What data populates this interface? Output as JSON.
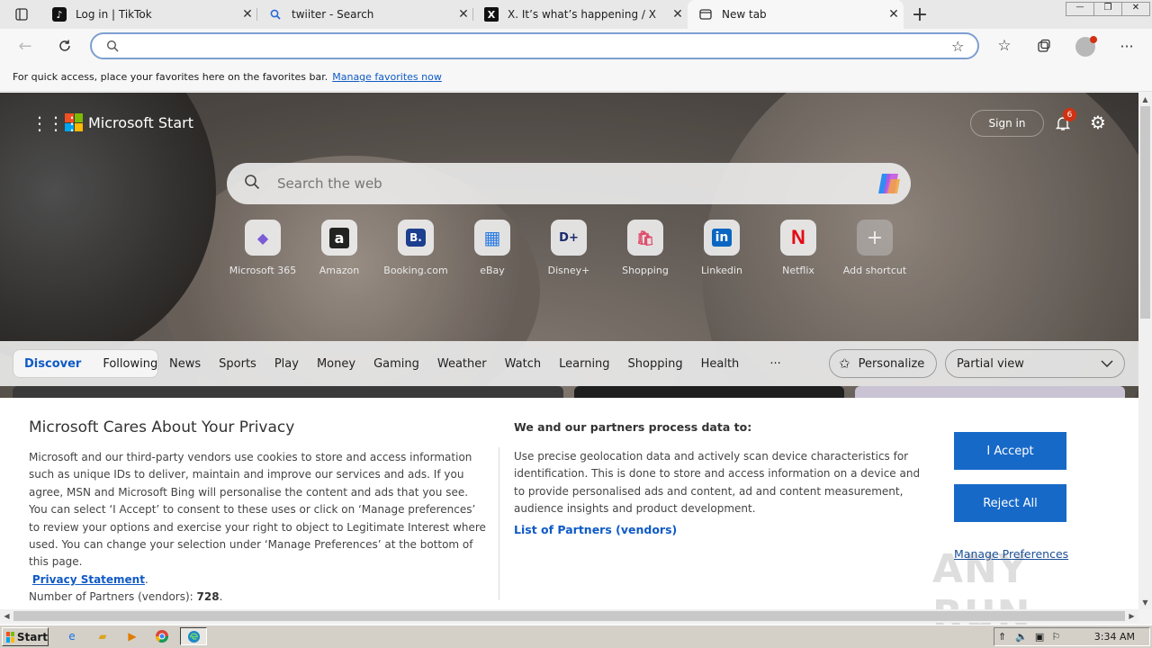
{
  "tabs": [
    {
      "title": "Log in | TikTok",
      "icon": "tiktok-icon"
    },
    {
      "title": "twiiter - Search",
      "icon": "search-icon"
    },
    {
      "title": "X. It’s what’s happening / X",
      "icon": "x-logo-icon"
    },
    {
      "title": "New tab",
      "icon": "new-tab-icon"
    }
  ],
  "tab_close": "✕",
  "new_tab_plus": "+",
  "window_controls": {
    "minimize": "—",
    "restore": "❐",
    "close": "✕"
  },
  "address": {
    "value": "",
    "placeholder": ""
  },
  "favorites_bar": {
    "text": "For quick access, place your favorites here on the favorites bar.",
    "link": "Manage favorites now"
  },
  "ms_start": {
    "brand": "Microsoft Start",
    "sign_in": "Sign in",
    "notifications_count": "6"
  },
  "web_search": {
    "placeholder": "Search the web"
  },
  "shortcuts": [
    {
      "label": "Microsoft 365",
      "glyph": "◆",
      "color": "#7b5cd6"
    },
    {
      "label": "Amazon",
      "glyph": "a",
      "color": "#222222"
    },
    {
      "label": "Booking.com",
      "glyph": "B.",
      "color": "#1d3f8f"
    },
    {
      "label": "eBay",
      "glyph": "▦",
      "color": "#2a7be4"
    },
    {
      "label": "Disney+",
      "glyph": "D+",
      "color": "#1a2a6c"
    },
    {
      "label": "Shopping",
      "glyph": "🛍",
      "color": "#e04a6a"
    },
    {
      "label": "Linkedin",
      "glyph": "in",
      "color": "#0a66c2"
    },
    {
      "label": "Netflix",
      "glyph": "N",
      "color": "#e50914"
    },
    {
      "label": "Add shortcut",
      "glyph": "+",
      "color": "#555555"
    }
  ],
  "nav": {
    "discover": "Discover",
    "following": "Following",
    "links": [
      "News",
      "Sports",
      "Play",
      "Money",
      "Gaming",
      "Weather",
      "Watch",
      "Learning",
      "Shopping",
      "Health"
    ],
    "more": "···",
    "personalize": "Personalize",
    "view_select": "Partial view"
  },
  "privacy": {
    "title": "Microsoft Cares About Your Privacy",
    "body": "Microsoft and our third-party vendors use cookies to store and access information such as unique IDs to deliver, maintain and improve our services and ads. If you agree, MSN and Microsoft Bing will personalise the content and ads that you see. You can select ‘I Accept’ to consent to these uses or click on ‘Manage preferences’ to review your options and exercise your right to object to Legitimate Interest where used.  You can change your selection under ‘Manage Preferences’ at the bottom of this page.",
    "privacy_link": "Privacy Statement",
    "partners_count_label": "Number of Partners (vendors):",
    "partners_count": "728",
    "right_title": "We and our partners process data to:",
    "right_body": "Use precise geolocation data and actively scan device characteristics for identification. This is done to store and access information on a device and to provide personalised ads and content, ad and content measurement, audience insights and product development.",
    "partners_link": "List of Partners (vendors)",
    "accept": "I Accept",
    "reject": "Reject All",
    "manage": "Manage Preferences"
  },
  "watermark": "ANY RUN",
  "taskbar": {
    "start": "Start",
    "clock": "3:34 AM"
  }
}
